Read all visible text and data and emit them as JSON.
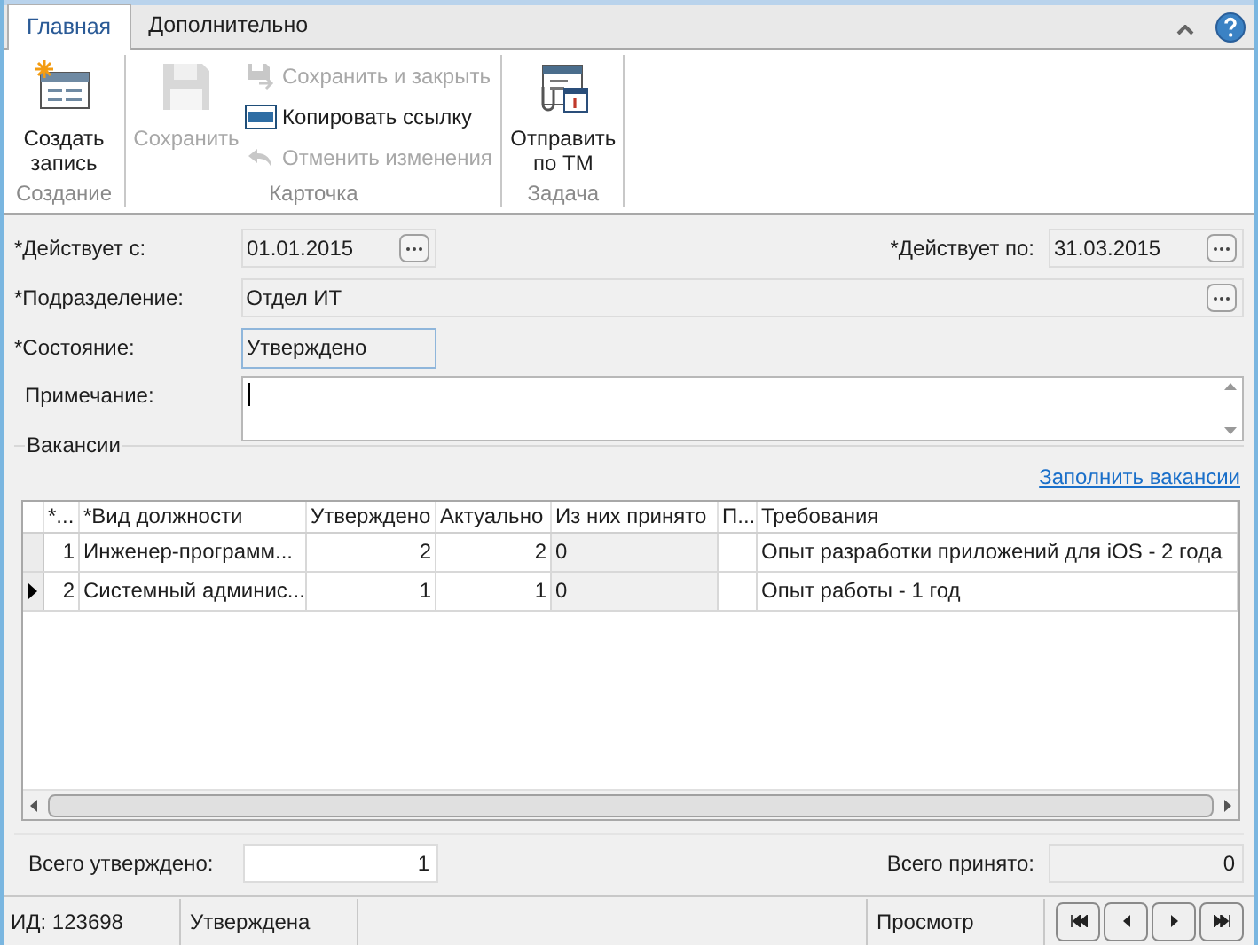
{
  "ribbon": {
    "tabs": [
      {
        "label": "Главная",
        "selected": true
      },
      {
        "label": "Дополнительно",
        "selected": false
      }
    ],
    "groups": [
      {
        "label": "Создание",
        "items": [
          {
            "kind": "large",
            "label": "Создать запись",
            "disabled": false
          }
        ]
      },
      {
        "label": "Карточка",
        "items": [
          {
            "kind": "large",
            "label": "Сохранить",
            "disabled": true
          },
          {
            "kind": "small",
            "label": "Сохранить и закрыть",
            "disabled": true
          },
          {
            "kind": "small",
            "label": "Копировать ссылку",
            "disabled": false
          },
          {
            "kind": "small",
            "label": "Отменить изменения",
            "disabled": true
          }
        ]
      },
      {
        "label": "Задача",
        "items": [
          {
            "kind": "large",
            "label": "Отправить по ТМ",
            "disabled": false
          }
        ]
      }
    ]
  },
  "form": {
    "valid_from": {
      "label": "*Действует с:",
      "value": "01.01.2015"
    },
    "valid_to": {
      "label": "*Действует по:",
      "value": "31.03.2015"
    },
    "department": {
      "label": "*Подразделение:",
      "value": "Отдел ИТ"
    },
    "state": {
      "label": "*Состояние:",
      "value": "Утверждено"
    },
    "note": {
      "label": "Примечание:"
    }
  },
  "vacancies": {
    "title": "Вакансии",
    "fill_link": "Заполнить вакансии",
    "table": {
      "columns": [
        "*...",
        "*Вид должности",
        "Утверждено",
        "Актуально",
        "Из них принято",
        "П...",
        "Требования"
      ],
      "rows": [
        {
          "selected": false,
          "cells": [
            "1",
            "Инженер-программ...",
            "2",
            "2",
            "0",
            "",
            "Опыт разработки приложений для iOS - 2 года"
          ]
        },
        {
          "selected": true,
          "cells": [
            "2",
            "Системный админис...",
            "1",
            "1",
            "0",
            "",
            "Опыт работы - 1 год"
          ]
        }
      ]
    }
  },
  "totals": {
    "approved": {
      "label": "Всего утверждено:",
      "value": "1"
    },
    "hired": {
      "label": "Всего принято:",
      "value": "0"
    }
  },
  "status_bar": {
    "id": "ИД: 123698",
    "state": "Утверждена",
    "mode": "Просмотр"
  }
}
